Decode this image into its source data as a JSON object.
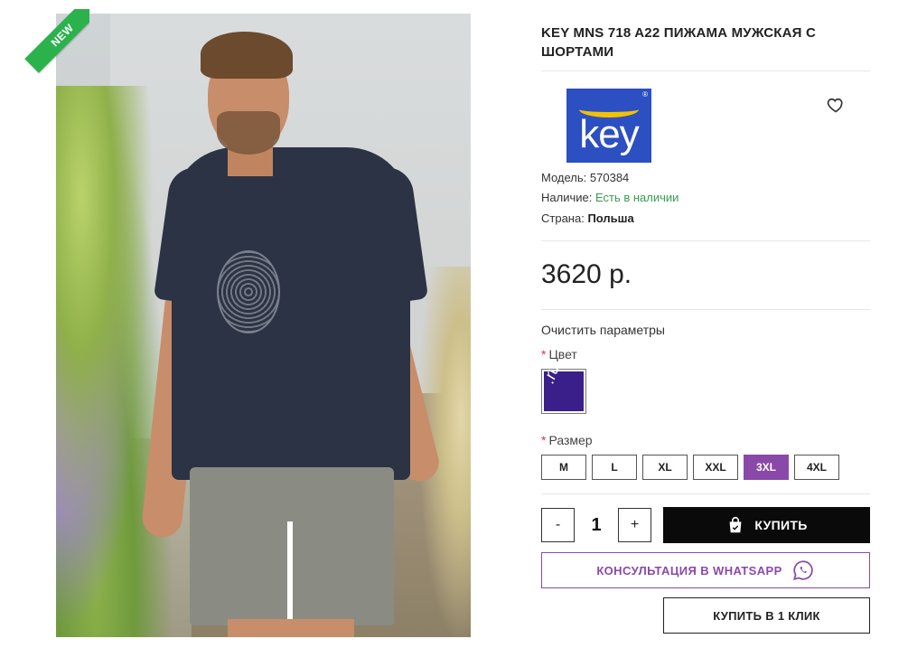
{
  "badge": {
    "label": "NEW"
  },
  "product": {
    "title": "KEY MNS 718 A22 ПИЖАМА МУЖСКАЯ С ШОРТАМИ",
    "brand_logo_text": "key",
    "model_label": "Модель:",
    "model_value": "570384",
    "availability_label": "Наличие:",
    "availability_value": "Есть в наличии",
    "country_label": "Страна:",
    "country_value": "Польша",
    "price": "3620 р."
  },
  "options": {
    "clear_label": "Очистить параметры",
    "required_mark": "*",
    "color_label": "Цвет",
    "color_swatch": {
      "color": "#3a1f8a",
      "text": ".ru"
    },
    "size_label": "Размер",
    "sizes": [
      "M",
      "L",
      "XL",
      "XXL",
      "3XL",
      "4XL"
    ],
    "selected_size": "3XL"
  },
  "cart": {
    "minus_label": "-",
    "quantity": "1",
    "plus_label": "+",
    "buy_label": "КУПИТЬ",
    "whatsapp_label": "КОНСУЛЬТАЦИЯ В WHATSAPP",
    "one_click_label": "КУПИТЬ В 1 КЛИК"
  },
  "icons": {
    "wishlist": "heart-icon",
    "buy": "shopping-bag-icon",
    "whatsapp": "whatsapp-icon"
  },
  "colors": {
    "accent": "#8a49a8",
    "in_stock": "#3a9a52",
    "new_badge": "#2bb24c",
    "buy_button": "#0a0a0a"
  }
}
